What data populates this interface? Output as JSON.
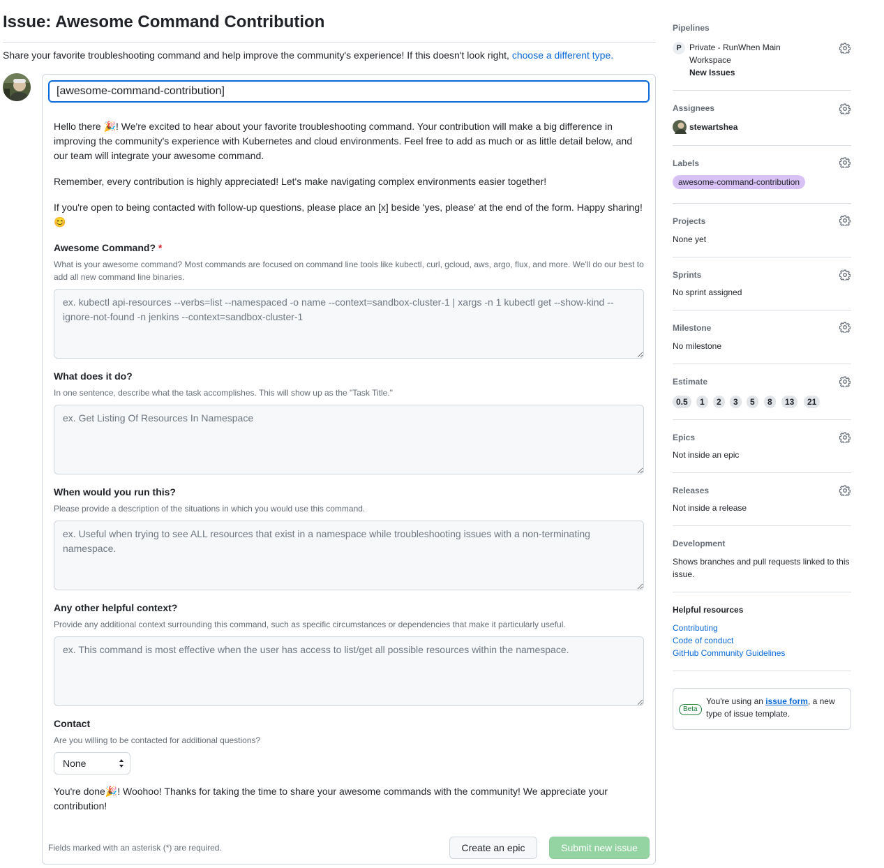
{
  "header": {
    "title": "Issue: Awesome Command Contribution",
    "intro_text": "Share your favorite troubleshooting command and help improve the community's experience! If this doesn't look right, ",
    "intro_link": "choose a different type."
  },
  "form": {
    "title_value": "[awesome-command-contribution]",
    "intro_paragraphs": [
      "Hello there 🎉! We're excited to hear about your favorite troubleshooting command. Your contribution will make a big difference in improving the community's experience with Kubernetes and cloud environments. Feel free to add as much or as little detail below, and our team will integrate your awesome command.",
      "Remember, every contribution is highly appreciated! Let's make navigating complex environments easier together!",
      "If you're open to being contacted with follow-up questions, please place an [x] beside 'yes, please' at the end of the form. Happy sharing! 😊"
    ],
    "fields": [
      {
        "label": "Awesome Command?",
        "required_marker": "*",
        "description": "What is your awesome command? Most commands are focused on command line tools like kubectl, curl, gcloud, aws, argo, flux, and more. We'll do our best to add all new command line binaries.",
        "placeholder": "ex. kubectl api-resources --verbs=list --namespaced -o name --context=sandbox-cluster-1 | xargs -n 1 kubectl get --show-kind --ignore-not-found -n jenkins --context=sandbox-cluster-1"
      },
      {
        "label": "What does it do?",
        "description": "In one sentence, describe what the task accomplishes. This will show up as the \"Task Title.\"",
        "placeholder": "ex. Get Listing Of Resources In Namespace"
      },
      {
        "label": "When would you run this?",
        "description": "Please provide a description of the situations in which you would use this command.",
        "placeholder": "ex. Useful when trying to see ALL resources that exist in a namespace while troubleshooting issues with a non-terminating namespace."
      },
      {
        "label": "Any other helpful context?",
        "description": "Provide any additional context surrounding this command, such as specific circumstances or dependencies that make it particularly useful.",
        "placeholder": "ex. This command is most effective when the user has access to list/get all possible resources within the namespace."
      }
    ],
    "contact": {
      "label": "Contact",
      "description": "Are you willing to be contacted for additional questions?",
      "selected": "None"
    },
    "outro": "You're done🎉! Woohoo! Thanks for taking the time to share your awesome commands with the community! We appreciate your contribution!",
    "required_note": "Fields marked with an asterisk (*) are required.",
    "create_epic_label": "Create an epic",
    "submit_label": "Submit new issue"
  },
  "sidebar": {
    "pipelines": {
      "heading": "Pipelines",
      "badge": "P",
      "name_line1": "Private - RunWhen Main",
      "name_line2": "Workspace",
      "pipeline": "New Issues"
    },
    "assignees": {
      "heading": "Assignees",
      "user": "stewartshea"
    },
    "labels": {
      "heading": "Labels",
      "label": "awesome-command-contribution"
    },
    "projects": {
      "heading": "Projects",
      "value": "None yet"
    },
    "sprints": {
      "heading": "Sprints",
      "value": "No sprint assigned"
    },
    "milestone": {
      "heading": "Milestone",
      "value": "No milestone"
    },
    "estimate": {
      "heading": "Estimate",
      "values": [
        "0.5",
        "1",
        "2",
        "3",
        "5",
        "8",
        "13",
        "21"
      ]
    },
    "epics": {
      "heading": "Epics",
      "value": "Not inside an epic"
    },
    "releases": {
      "heading": "Releases",
      "value": "Not inside a release"
    },
    "development": {
      "heading": "Development",
      "value": "Shows branches and pull requests linked to this issue."
    },
    "helpful": {
      "heading": "Helpful resources",
      "links": [
        "Contributing",
        "Code of conduct",
        "GitHub Community Guidelines"
      ]
    },
    "beta": {
      "badge": "Beta",
      "text_before": "You're using an ",
      "link": "issue form",
      "text_after": ", a new type of issue template."
    }
  },
  "colors": {
    "accent": "#0969da",
    "label_bg": "#d8c2f5",
    "submit_bg": "#94d3a2",
    "required": "#cf222e"
  }
}
